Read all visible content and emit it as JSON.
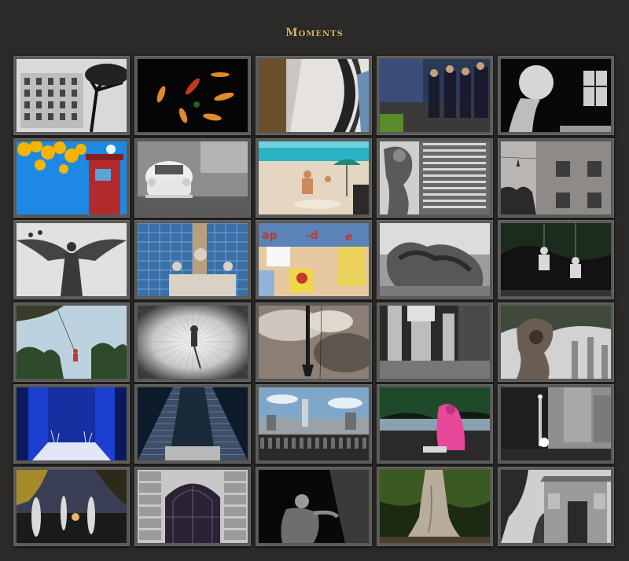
{
  "page": {
    "title": "Moments",
    "background_color": "#2b2a29",
    "title_color": "#d8b764"
  },
  "gallery": {
    "columns": 5,
    "rows": 6,
    "items": [
      {
        "scene": "bw-building-tree"
      },
      {
        "scene": "falling-leaves-dark"
      },
      {
        "scene": "sculpture-curves"
      },
      {
        "scene": "police-street"
      },
      {
        "scene": "statue-head-window"
      },
      {
        "scene": "yellow-flowers-column"
      },
      {
        "scene": "vw-beetle"
      },
      {
        "scene": "beach-umbrella"
      },
      {
        "scene": "statue-tower-bw"
      },
      {
        "scene": "shoes-wire"
      },
      {
        "scene": "angel-wings-sky"
      },
      {
        "scene": "angel-monument-glass"
      },
      {
        "scene": "posters-wall"
      },
      {
        "scene": "reclining-sculpture"
      },
      {
        "scene": "flying-dancers-night"
      },
      {
        "scene": "pole-flyer-sky"
      },
      {
        "scene": "flyer-radial-blur"
      },
      {
        "scene": "pole-clouds"
      },
      {
        "scene": "columns-bw"
      },
      {
        "scene": "sculpture-trees"
      },
      {
        "scene": "blue-walls-fountain"
      },
      {
        "scene": "tower-perspective"
      },
      {
        "scene": "city-skyline-balustrade"
      },
      {
        "scene": "woman-pink-shawl"
      },
      {
        "scene": "angel-column-city"
      },
      {
        "scene": "fountain-dusk"
      },
      {
        "scene": "gothic-door"
      },
      {
        "scene": "dark-statue"
      },
      {
        "scene": "tree-trunk"
      },
      {
        "scene": "old-house-bw"
      }
    ]
  }
}
